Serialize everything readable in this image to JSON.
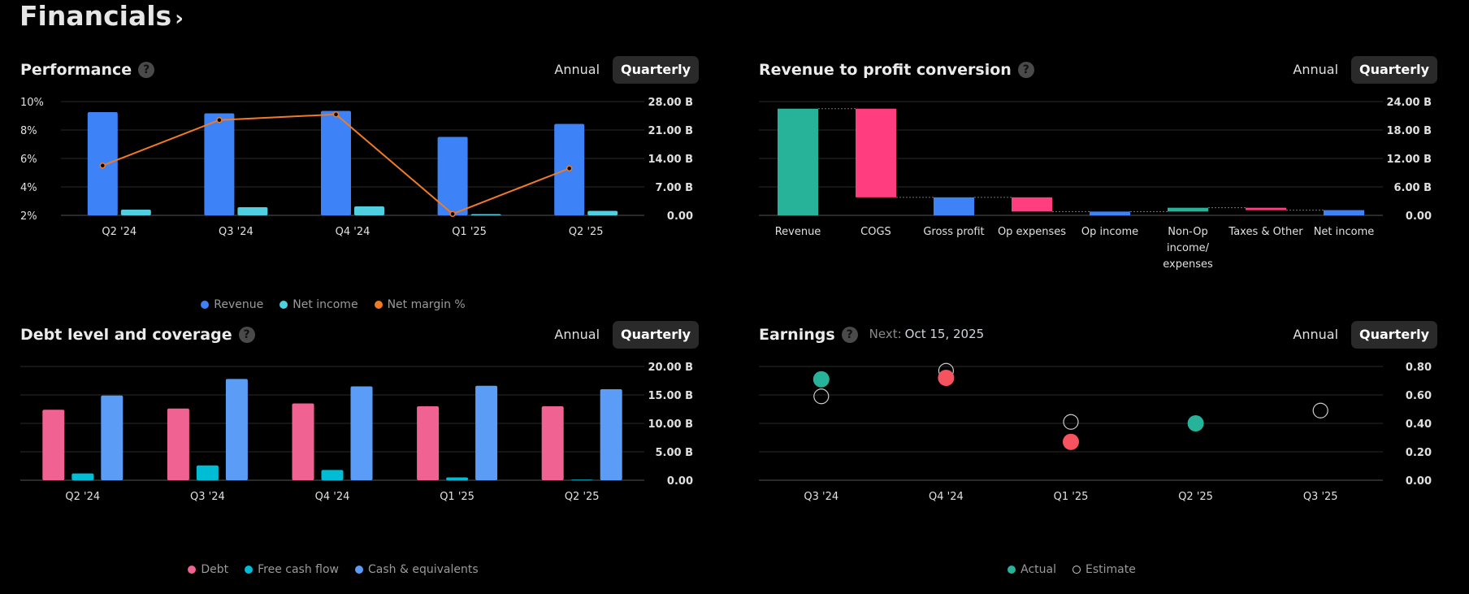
{
  "page": {
    "title": "Financials"
  },
  "tabs": {
    "annual": "Annual",
    "quarterly": "Quarterly"
  },
  "panels": {
    "performance": {
      "title": "Performance",
      "help": "?"
    },
    "conversion": {
      "title": "Revenue to profit conversion",
      "help": "?"
    },
    "debt": {
      "title": "Debt level and coverage",
      "help": "?"
    },
    "earnings": {
      "title": "Earnings",
      "help": "?",
      "next_label": "Next:",
      "next_date": "Oct 15, 2025"
    }
  },
  "chart_data": [
    {
      "id": "performance",
      "type": "bar",
      "categories": [
        "Q2 '24",
        "Q3 '24",
        "Q4 '24",
        "Q1 '25",
        "Q2 '25"
      ],
      "left_ticks": [
        "10%",
        "8%",
        "6%",
        "4%",
        "2%"
      ],
      "right_ticks": [
        "28.00 B",
        "21.00 B",
        "14.00 B",
        "7.00 B",
        "0.00"
      ],
      "ylim": [
        0,
        28
      ],
      "ylim_left": [
        2,
        10
      ],
      "series": [
        {
          "name": "Revenue",
          "kind": "bar",
          "color": "#3d82f6",
          "values": [
            25.4,
            25.1,
            25.7,
            19.3,
            22.5
          ]
        },
        {
          "name": "Net income",
          "kind": "bar",
          "color": "#4fcfe0",
          "values": [
            1.4,
            2.0,
            2.2,
            0.3,
            1.1
          ]
        },
        {
          "name": "Net margin %",
          "kind": "line",
          "axis": "left",
          "color": "#f07b26",
          "values": [
            5.5,
            8.7,
            9.1,
            2.1,
            5.3
          ]
        }
      ]
    },
    {
      "id": "conversion",
      "type": "bar",
      "subtype": "waterfall",
      "categories": [
        [
          "Revenue"
        ],
        [
          "COGS"
        ],
        [
          "Gross profit"
        ],
        [
          "Op expenses"
        ],
        [
          "Op income"
        ],
        [
          "Non-Op",
          "income/",
          "expenses"
        ],
        [
          "Taxes & Other"
        ],
        [
          "Net income"
        ]
      ],
      "right_ticks": [
        "24.00 B",
        "18.00 B",
        "12.00 B",
        "6.00 B",
        "0.00"
      ],
      "ylim": [
        0,
        24
      ],
      "steps": [
        {
          "start": 0,
          "end": 22.5,
          "color": "#26b39a"
        },
        {
          "start": 22.5,
          "end": 3.8,
          "color": "#ff3d7f"
        },
        {
          "start": 0,
          "end": 3.8,
          "color": "#3d82f6"
        },
        {
          "start": 3.8,
          "end": 0.8,
          "color": "#ff3d7f"
        },
        {
          "start": 0,
          "end": 0.8,
          "color": "#3d82f6"
        },
        {
          "start": 0.8,
          "end": 1.6,
          "color": "#26b39a"
        },
        {
          "start": 1.6,
          "end": 1.1,
          "color": "#ff3d7f"
        },
        {
          "start": 0,
          "end": 1.1,
          "color": "#3d82f6"
        }
      ]
    },
    {
      "id": "debt",
      "type": "bar",
      "categories": [
        "Q2 '24",
        "Q3 '24",
        "Q4 '24",
        "Q1 '25",
        "Q2 '25"
      ],
      "right_ticks": [
        "20.00 B",
        "15.00 B",
        "10.00 B",
        "5.00 B",
        "0.00"
      ],
      "ylim": [
        0,
        20
      ],
      "series": [
        {
          "name": "Debt",
          "color": "#f06292",
          "values": [
            12.4,
            12.6,
            13.5,
            13.0,
            13.0
          ]
        },
        {
          "name": "Free cash flow",
          "color": "#00bcd4",
          "values": [
            1.2,
            2.6,
            1.8,
            0.5,
            0.1
          ]
        },
        {
          "name": "Cash & equivalents",
          "color": "#5b9cf6",
          "values": [
            14.9,
            17.8,
            16.5,
            16.6,
            16.0
          ]
        }
      ]
    },
    {
      "id": "earnings",
      "type": "scatter",
      "categories": [
        "Q3 '24",
        "Q4 '24",
        "Q1 '25",
        "Q2 '25",
        "Q3 '25"
      ],
      "right_ticks": [
        "0.80",
        "0.60",
        "0.40",
        "0.20",
        "0.00"
      ],
      "ylim": [
        0,
        0.8
      ],
      "actual": [
        0.71,
        0.72,
        0.27,
        0.4,
        null
      ],
      "actual_colors": [
        "#26b39a",
        "#f7525f",
        "#f7525f",
        "#26b39a",
        null
      ],
      "estimate": [
        0.59,
        0.77,
        0.41,
        null,
        0.49
      ],
      "series": [
        {
          "name": "Actual",
          "color": "#26b39a"
        },
        {
          "name": "Estimate",
          "color": "#cccccc"
        }
      ]
    }
  ]
}
